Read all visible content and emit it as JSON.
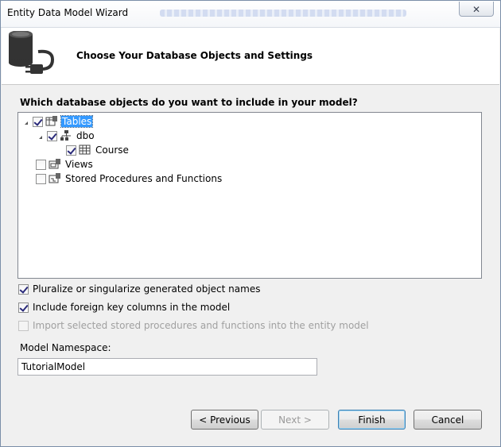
{
  "window": {
    "title": "Entity Data Model Wizard",
    "close_label": "✕"
  },
  "header": {
    "title": "Choose Your Database Objects and Settings"
  },
  "question": "Which database objects do you want to include in your model?",
  "tree": {
    "tables": {
      "label": "Tables",
      "checked": true,
      "expanded": true,
      "selected": true
    },
    "dbo": {
      "label": "dbo",
      "checked": true,
      "expanded": true
    },
    "course": {
      "label": "Course",
      "checked": true
    },
    "views": {
      "label": "Views",
      "checked": false
    },
    "stored": {
      "label": "Stored Procedures and Functions",
      "checked": false
    }
  },
  "options": {
    "pluralize": {
      "label": "Pluralize or singularize generated object names",
      "checked": true
    },
    "foreign_keys": {
      "label": "Include foreign key columns in the model",
      "checked": true
    },
    "import_sp": {
      "label": "Import selected stored procedures and functions into the entity model",
      "checked": false,
      "disabled": true
    }
  },
  "namespace": {
    "label": "Model Namespace:",
    "value": "TutorialModel"
  },
  "buttons": {
    "previous": "< Previous",
    "next": "Next >",
    "finish": "Finish",
    "cancel": "Cancel"
  },
  "colors": {
    "selection": "#3399ff",
    "accent_border": "#3c7fb1"
  }
}
